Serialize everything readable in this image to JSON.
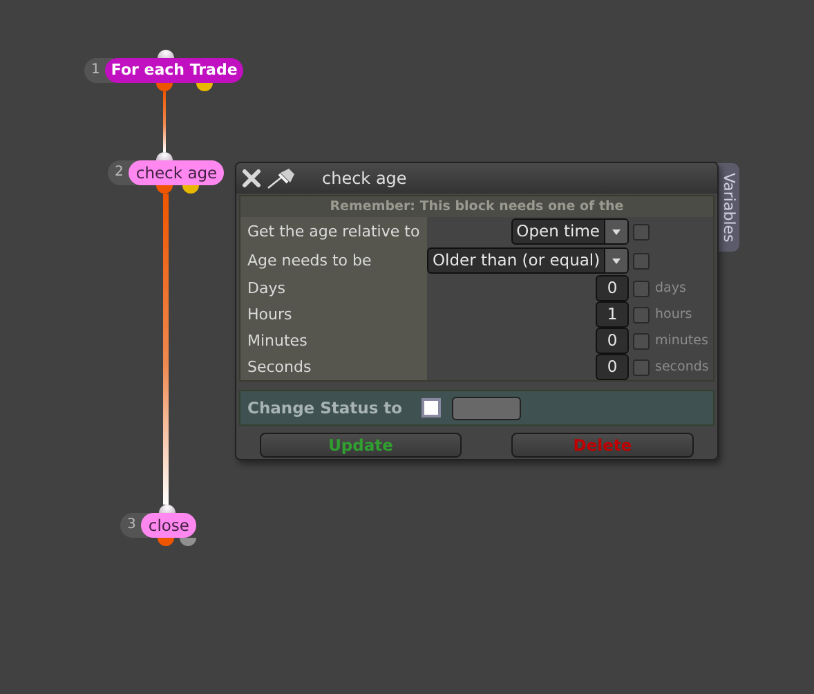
{
  "nodes": [
    {
      "number": "1",
      "label": "For each Trade",
      "kind": "loop",
      "color": "#c010c0",
      "outputs": [
        {
          "color": "#ee5500",
          "connected": true
        },
        {
          "color": "#e8b800",
          "connected": false
        }
      ]
    },
    {
      "number": "2",
      "label": "check age",
      "kind": "action",
      "color": "#ff88f0",
      "outputs": [
        {
          "color": "#ee5500",
          "connected": true
        },
        {
          "color": "#e8b800",
          "connected": false
        }
      ]
    },
    {
      "number": "3",
      "label": "close",
      "kind": "action",
      "color": "#ff88f0",
      "outputs": [
        {
          "color": "#ee5500"
        },
        {
          "color": "#909090"
        }
      ]
    }
  ],
  "panel": {
    "title": "check age",
    "side_tab": "Variables",
    "notice": "Remember: This block needs one of the",
    "rows": [
      {
        "kind": "select",
        "label": "Get the age relative to",
        "value": "Open time",
        "checked": false
      },
      {
        "kind": "select",
        "label": "Age needs to be",
        "value": "Older than (or equal)",
        "checked": false
      },
      {
        "kind": "number",
        "label": "Days",
        "value": "0",
        "checked": false,
        "unit": "days"
      },
      {
        "kind": "number",
        "label": "Hours",
        "value": "1",
        "checked": false,
        "unit": "hours"
      },
      {
        "kind": "number",
        "label": "Minutes",
        "value": "0",
        "checked": false,
        "unit": "minutes"
      },
      {
        "kind": "number",
        "label": "Seconds",
        "value": "0",
        "checked": false,
        "unit": "seconds"
      }
    ],
    "status": {
      "label": "Change Status to",
      "checked": false
    },
    "buttons": [
      {
        "label": "Update",
        "color": "#30a030"
      },
      {
        "label": "Delete",
        "color": "#c00000"
      }
    ]
  }
}
